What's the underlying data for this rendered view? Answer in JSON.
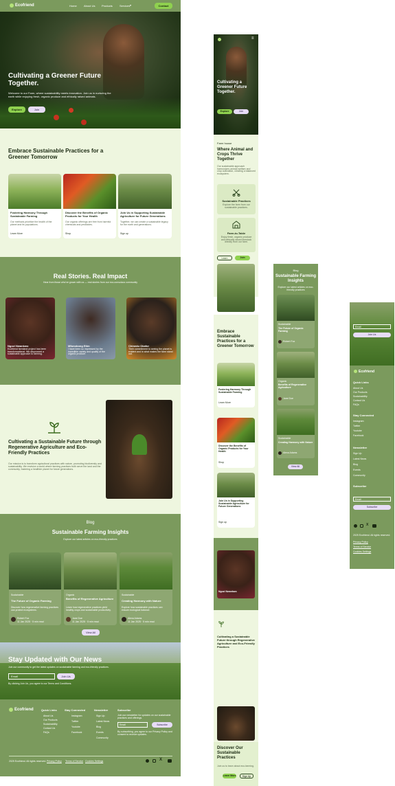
{
  "desktop": {
    "nav": {
      "logo": "Ecofriend",
      "links": [
        "Home",
        "About Us",
        "Products",
        "Services"
      ],
      "cta": "Contact"
    },
    "hero": {
      "title": "Cultivating a Greener Future Together.",
      "body": "Welcome to our Farm, where sustainability meets innovation. Join us in nurturing the earth while enjoying fresh, organic produce and ethically raised animals.",
      "btn_primary": "Explore",
      "btn_secondary": "Join"
    },
    "practices": {
      "title": "Embrace Sustainable Practices for a Greener Tomorrow",
      "cards": [
        {
          "title": "Fostering Harmony Through Sustainable Farming",
          "body": "Our methods prioritize the health of the planet and its populations.",
          "link": "Learn More"
        },
        {
          "title": "Discover the Benefits of Organic Products for Your Health",
          "body": "Our organic offerings are free from harmful chemicals and pesticides.",
          "link": "Shop"
        },
        {
          "title": "Join Us in Supporting Sustainable Agriculture for Future Generations",
          "body": "Together, we can create a sustainable legacy for the earth and generations.",
          "link": "Sign up"
        }
      ]
    },
    "stories": {
      "title": "Real Stories. Real Impact",
      "subtitle": "Hear from those who've grown with us — real stories from our eco-conscious community",
      "people": [
        {
          "name": "Ngozi Nwankwo",
          "quote": "Ecofriend farmland project has been transformational. We discovered a sustainable approach to farming."
        },
        {
          "name": "Mfonobong Etim",
          "quote": "I have been so impressed by the incredible variety and quality of the organic produce."
        },
        {
          "name": "Chinedu Okafor",
          "quote": "Their commitment to seeing the planet is evident and is what makes the farm stand out."
        }
      ]
    },
    "regen": {
      "title": "Cultivating a Sustainable Future through Regenerative Agriculture and Eco-Friendly Practices",
      "body": "Our mission is to transform agricultural practices with nature, promoting biodiversity and sustainability. We envision a world where farming practices both serve the land and the community, fostering a healthier planet for future generations."
    },
    "blog": {
      "eyebrow": "Blog",
      "title": "Sustainable Farming Insights",
      "subtitle": "Explore our latest articles on eco-friendly practices",
      "posts": [
        {
          "tag": "Sustainable",
          "title": "The Future of Organic Farming",
          "body": "Discover how regenerative farming practices can protect ecosystems.",
          "author": "Robert Fox",
          "meta": "11 Jan 2025 · 5 min read"
        },
        {
          "tag": "Organic",
          "title": "Benefits of Regenerative Agriculture",
          "body": "Learn how regenerative practices yield healthy crops and sustainable productivity.",
          "author": "Jane Doe",
          "meta": "11 Jan 2025 · 5 min read"
        },
        {
          "tag": "Sustainable",
          "title": "Creating Harmony with Nature",
          "body": "Explore how sustainable practices can ensure ecological balance.",
          "author": "Alexa Adams",
          "meta": "11 Jan 2025 · 5 min read"
        }
      ],
      "view_all": "View All"
    },
    "newsletter": {
      "title": "Stay Updated with Our News",
      "body": "Join our community to get the latest updates on sustainable farming and eco-friendly practices.",
      "placeholder": "Email",
      "button": "Join Us",
      "fine": "By clicking Join Us, you agree to our Terms and Conditions."
    },
    "footer": {
      "logo": "Ecofriend",
      "cols": [
        {
          "title": "Quick Links",
          "items": [
            "About Us",
            "Our Products",
            "Sustainability",
            "Contact Us",
            "FAQs"
          ]
        },
        {
          "title": "Stay Connected",
          "items": [
            "Instagram",
            "Twitter",
            "Youtube",
            "Facebook"
          ]
        },
        {
          "title": "Newsletter",
          "items": [
            "Sign Up",
            "Latest News",
            "Blog",
            "Events",
            "Community"
          ]
        }
      ],
      "subscribe_title": "Subscribe",
      "subscribe_body": "Join our newsletter for updates on our sustainable practices and offerings.",
      "subscribe_placeholder": "Email",
      "subscribe_button": "Subscribe",
      "subscribe_fine": "By subscribing, you agree to our Privacy Policy and consent to receive updates.",
      "copyright": "2025 Ecofriend. All rights reserved.",
      "legal": [
        "Privacy Policy",
        "Terms of Service",
        "Cookies Settings"
      ]
    }
  },
  "mobile1": {
    "hero": {
      "title": "Cultivating a Greener Future Together.",
      "btn_primary": "Explore",
      "btn_secondary": "Join"
    },
    "farmhouse": {
      "eyebrow": "Farm house",
      "title": "Where Animal and Crops Thrive Together",
      "body": "Our sustainable approach harmonizes animal welfare and crop cultivation, creating a balanced ecosystem.",
      "feature1": "Sustainable Practices",
      "feature1_body": "Explore the farm from our sustainable practices.",
      "feature2": "Farm-to-Table",
      "feature2_body": "Enjoy fresh, organic produce and ethically raised livestock directly from our farm.",
      "btn1": "Learn",
      "btn2": "Join"
    },
    "practices": {
      "title": "Embrace Sustainable Practices for a Greener Tomorrow",
      "cards": [
        {
          "title": "Fostering Harmony Through Sustainable Farming",
          "link": "Learn More"
        },
        {
          "title": "Discover the Benefits of Organic Products for Your Health",
          "link": "Shop"
        },
        {
          "title": "Join Us in Supporting Sustainable Agriculture for Future Generations",
          "link": "Sign up"
        }
      ]
    },
    "story_name": "Ngozi Nwankwo",
    "regen_title": "Cultivating a Sustainable Future through Regenerative Agriculture and Eco-Friendly Practices",
    "discover": {
      "title": "Discover Our Sustainable Practices",
      "body": "Join us to learn about eco-farming.",
      "btn1": "Learn More",
      "btn2": "Sign Up"
    }
  },
  "mobile2": {
    "eyebrow": "Blog",
    "title": "Sustainable Farming Insights",
    "subtitle": "Explore our latest articles on eco-friendly practices",
    "posts": [
      {
        "tag": "Sustainable",
        "title": "The Future of Organic Farming",
        "author": "Robert Fox"
      },
      {
        "tag": "Organic",
        "title": "Benefits of Regenerative Agriculture",
        "author": "Jane Doe"
      },
      {
        "tag": "Sustainable",
        "title": "Creating Harmony with Nature",
        "author": "Alexa Adams"
      }
    ],
    "view_all": "View All"
  },
  "mobile3": {
    "email_placeholder": "Email",
    "join_button": "Join Us",
    "logo": "Ecofriend",
    "cols": [
      {
        "title": "Quick Links",
        "items": [
          "About Us",
          "Our Products",
          "Sustainability",
          "Contact Us",
          "FAQs"
        ]
      },
      {
        "title": "Stay Connected",
        "items": [
          "Instagram",
          "Twitter",
          "Youtube",
          "Facebook"
        ]
      },
      {
        "title": "Newsletter",
        "items": [
          "Sign Up",
          "Latest News",
          "Blog",
          "Events",
          "Community"
        ]
      }
    ],
    "subscribe_title": "Subscribe",
    "subscribe_placeholder": "Email",
    "subscribe_button": "Subscribe",
    "copyright": "2025 Ecofriend. All rights reserved.",
    "legal": [
      "Privacy Policy",
      "Terms of Service",
      "Cookies Settings"
    ]
  },
  "colors": {
    "olive": "#7b9a5d",
    "lime": "#8fd14f",
    "cream": "#eef6df",
    "lavender": "#e7dcf7"
  }
}
